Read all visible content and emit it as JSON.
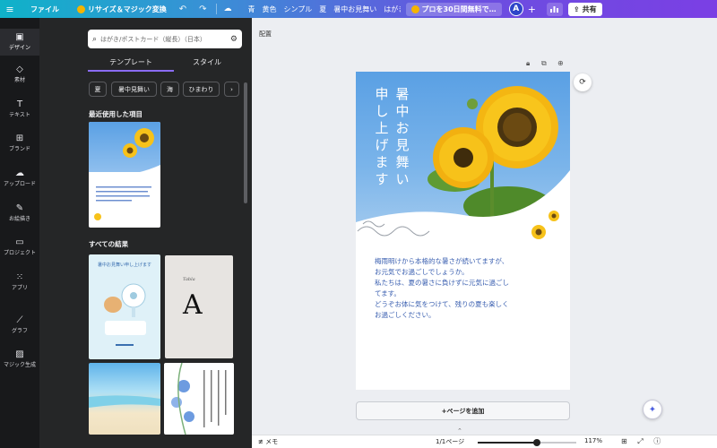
{
  "topbar": {
    "file": "ファイル",
    "resize": "リサイズ＆マジック変換",
    "design_title": "青　黄色　シンプル　夏　暑中お見舞い　はがき…",
    "pro_trial": "プロを30日間無料で…",
    "avatar": "A",
    "share": "共有"
  },
  "rail": [
    {
      "label": "デザイン",
      "icon": "template-icon"
    },
    {
      "label": "素材",
      "icon": "elements-icon"
    },
    {
      "label": "テキスト",
      "icon": "text-icon"
    },
    {
      "label": "ブランド",
      "icon": "brand-icon"
    },
    {
      "label": "アップロード",
      "icon": "upload-icon"
    },
    {
      "label": "お絵描き",
      "icon": "draw-icon"
    },
    {
      "label": "プロジェクト",
      "icon": "folder-icon"
    },
    {
      "label": "アプリ",
      "icon": "apps-icon"
    },
    {
      "label": "グラフ",
      "icon": "chart-icon"
    },
    {
      "label": "マジック生成",
      "icon": "magic-icon"
    }
  ],
  "panel": {
    "search_placeholder": "はがき/ポストカード（縦長）（日本）",
    "tabs": [
      "テンプレート",
      "スタイル"
    ],
    "chips": [
      "夏",
      "暑中見舞い",
      "海",
      "ひまわり",
      "›"
    ],
    "recent_heading": "最近使用した項目",
    "all_results_heading": "すべての結果",
    "thumb_texts": {
      "summer_title": "暑中お見舞い申し上げます",
      "letter_a": "A",
      "serif_word": "Tabla"
    }
  },
  "workspace": {
    "label": "配置",
    "add_page": "+ページを追加"
  },
  "page": {
    "heading_col_right": "暑中お見舞い",
    "heading_col_left": "申し上げます",
    "body_lines": [
      "梅雨明けから本格的な暑さが続いてますが、",
      "お元気でお過ごしでしょうか。",
      "私たちは、夏の暑さに負けずに元気に過ごし",
      "てます。",
      "どうぞお体に気をつけて、残りの夏も楽しく",
      "お過ごしください。"
    ]
  },
  "bottombar": {
    "notes": "メモ",
    "page_indicator": "1/1ページ",
    "zoom": "117%",
    "zoom_fraction": 0.6
  },
  "colors": {
    "accent": "#7b3fe4",
    "sky": "#5aa0e4",
    "body_text": "#3a5fb0"
  }
}
